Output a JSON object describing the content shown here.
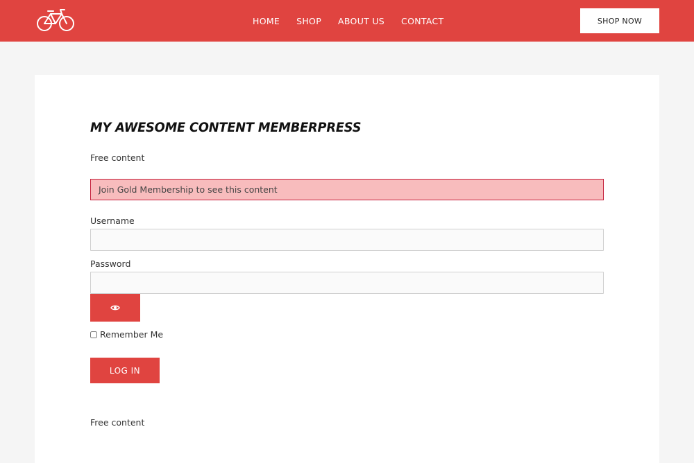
{
  "header": {
    "logo_icon": "bicycle-icon",
    "nav": [
      {
        "label": "HOME"
      },
      {
        "label": "SHOP"
      },
      {
        "label": "ABOUT US"
      },
      {
        "label": "CONTACT"
      }
    ],
    "cta_label": "SHOP NOW",
    "background_color": "#e04440"
  },
  "content": {
    "title": "MY AWESOME CONTENT MEMBERPRESS",
    "free_content_top": "Free content",
    "notice": "Join Gold Membership to see this content",
    "username_label": "Username",
    "username_value": "",
    "password_label": "Password",
    "password_value": "",
    "show_password_icon": "eye-icon",
    "remember_label": "Remember Me",
    "remember_checked": false,
    "login_label": "LOG IN",
    "free_content_bottom": "Free content"
  }
}
